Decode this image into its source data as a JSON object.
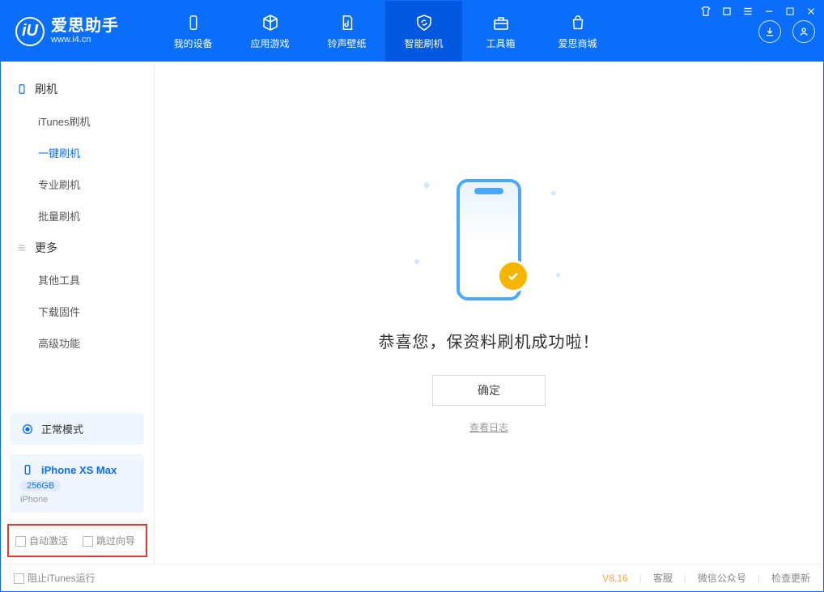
{
  "app": {
    "logo_char": "iU",
    "title": "爱思助手",
    "subtitle": "www.i4.cn"
  },
  "nav": {
    "my_device": "我的设备",
    "apps_games": "应用游戏",
    "ring_wall": "铃声壁纸",
    "smart_flash": "智能刷机",
    "toolbox": "工具箱",
    "store": "爱思商城"
  },
  "sidebar": {
    "flash_header": "刷机",
    "items": {
      "itunes": "iTunes刷机",
      "onekey": "一键刷机",
      "pro": "专业刷机",
      "batch": "批量刷机"
    },
    "more_header": "更多",
    "more": {
      "other_tools": "其他工具",
      "download_fw": "下载固件",
      "advanced": "高级功能"
    },
    "mode_panel": {
      "label": "正常模式"
    },
    "device_panel": {
      "name": "iPhone XS Max",
      "storage": "256GB",
      "type": "iPhone"
    },
    "checks": {
      "auto_activate": "自动激活",
      "skip_guide": "跳过向导"
    }
  },
  "main": {
    "success": "恭喜您，保资料刷机成功啦！",
    "ok": "确定",
    "view_log": "查看日志"
  },
  "status": {
    "block_itunes": "阻止iTunes运行",
    "version": "V8.16",
    "support": "客服",
    "wechat": "微信公众号",
    "check_update": "检查更新"
  }
}
